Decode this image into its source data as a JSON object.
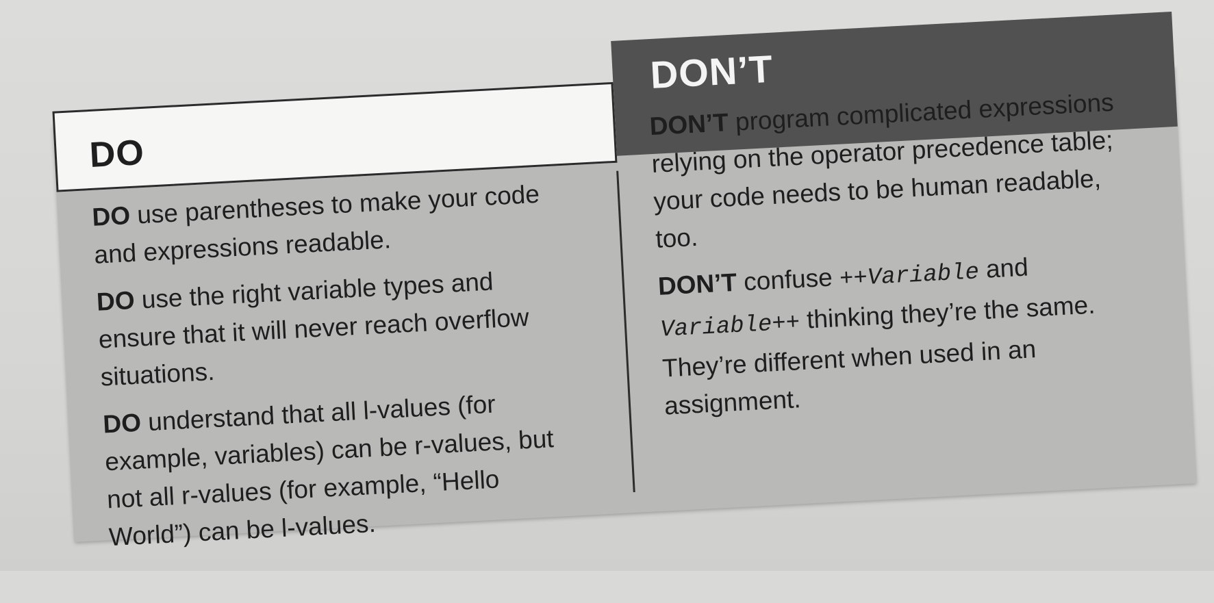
{
  "do_header": "DO",
  "dont_header": "DON’T",
  "do_items": [
    {
      "keyword": "DO",
      "text": " use parentheses to make your code and expressions readable."
    },
    {
      "keyword": "DO",
      "text": " use the right variable types and ensure that it will never reach overflow situations."
    },
    {
      "keyword": "DO",
      "text": " understand that all l-values (for example, variables) can be r-values, but not all r-values (for example, “Hello World”) can be l-values."
    }
  ],
  "dont_items": [
    {
      "keyword": "DON’T",
      "text": " program complicated expressions relying on the operator precedence table; your code needs to be human readable, too."
    },
    {
      "keyword": "DON’T",
      "text_before": " confuse ",
      "code1": "++Variable",
      "text_mid": " and ",
      "code2": "Variable++",
      "text_after": " thinking they’re the same. They’re different when used in an assignment."
    }
  ],
  "colors": {
    "dont_header_bg": "#515151",
    "box_bg": "#b9b9b7"
  }
}
